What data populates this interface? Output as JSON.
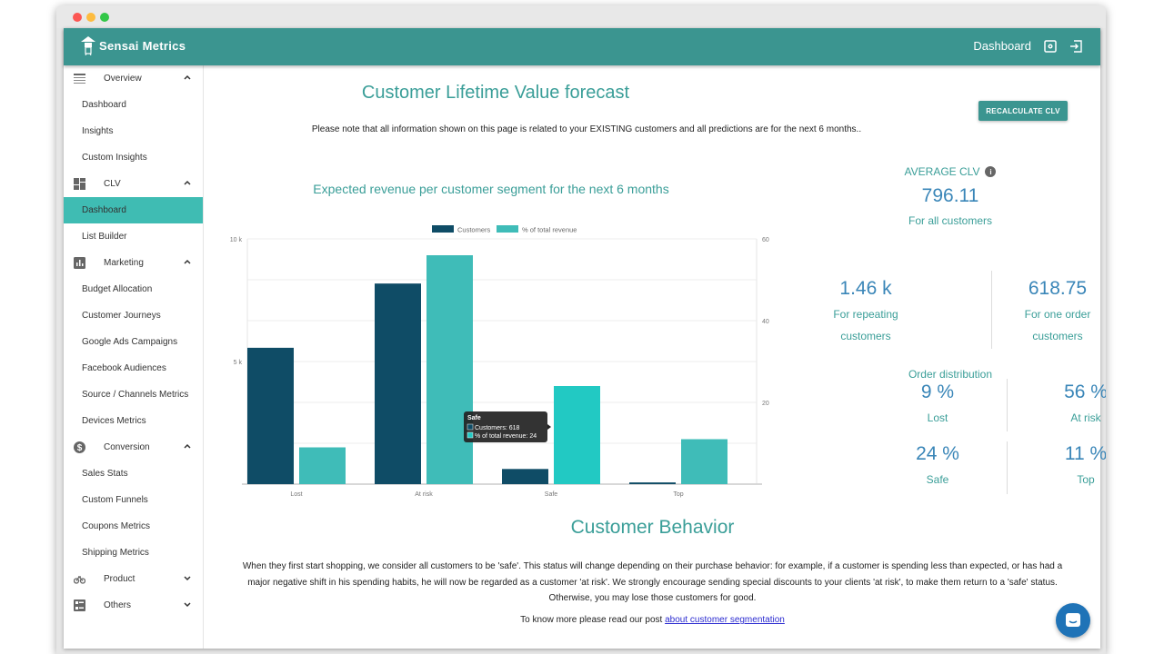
{
  "app": {
    "name": "Sensai Metrics",
    "header_page_label": "Dashboard"
  },
  "sidebar": {
    "groups": [
      {
        "label": "Overview",
        "icon": "table-icon",
        "expanded": true,
        "items": [
          "Dashboard",
          "Insights",
          "Custom Insights"
        ]
      },
      {
        "label": "CLV",
        "icon": "dashboard-icon",
        "expanded": true,
        "items": [
          "Dashboard",
          "List Builder"
        ],
        "active_item": "Dashboard"
      },
      {
        "label": "Marketing",
        "icon": "bar-chart-icon",
        "expanded": true,
        "items": [
          "Budget Allocation",
          "Customer Journeys",
          "Google Ads Campaigns",
          "Facebook Audiences",
          "Source / Channels Metrics",
          "Devices Metrics"
        ]
      },
      {
        "label": "Conversion",
        "icon": "dollar-icon",
        "expanded": true,
        "items": [
          "Sales Stats",
          "Custom Funnels",
          "Coupons Metrics",
          "Shipping Metrics"
        ]
      },
      {
        "label": "Product",
        "icon": "bike-icon",
        "expanded": false,
        "items": []
      },
      {
        "label": "Others",
        "icon": "list-icon",
        "expanded": false,
        "items": []
      }
    ]
  },
  "main": {
    "title": "Customer Lifetime Value forecast",
    "notice": "Please note that all information shown on this page is related to your EXISTING customers and all predictions are for the next 6 months..",
    "recalc_button": "RECALCULATE CLV",
    "average": {
      "label": "AVERAGE CLV",
      "value": "796.11",
      "sub": "For all customers"
    },
    "repeating": {
      "value": "1.46 k",
      "sub1": "For repeating",
      "sub2": "customers"
    },
    "one_order": {
      "value": "618.75",
      "sub1": "For one order",
      "sub2": "customers"
    },
    "order_distribution": {
      "title": "Order distribution",
      "items": [
        {
          "value": "9 %",
          "label": "Lost"
        },
        {
          "value": "56 %",
          "label": "At risk"
        },
        {
          "value": "24 %",
          "label": "Safe"
        },
        {
          "value": "11 %",
          "label": "Top"
        }
      ]
    },
    "behavior": {
      "title": "Customer Behavior",
      "line1": "When they first start shopping, we consider all customers to be 'safe'. This status will change depending on their purchase behavior: for example, if a customer is spending less than expected, or has had a",
      "line2": "major negative shift in his spending habits, he will now be regarded as a customer 'at risk'. We strongly encourage sending special discounts to your clients 'at risk', to make them return to a 'safe' status.",
      "line3": "Otherwise, you may lose those customers for good.",
      "more_prefix": "To know more please read our post ",
      "more_link": "about customer segmentation"
    }
  },
  "chart_data": {
    "type": "bar",
    "title": "Expected revenue per customer segment for the next 6 months",
    "categories": [
      "Lost",
      "At risk",
      "Safe",
      "Top"
    ],
    "series": [
      {
        "name": "Customers",
        "axis": "left",
        "color": "#0f4c66",
        "values": [
          5560,
          8180,
          618,
          70
        ]
      },
      {
        "name": "% of total revenue",
        "axis": "right",
        "color": "#3fbcb8",
        "values": [
          9,
          56,
          24,
          11
        ]
      }
    ],
    "left_axis": {
      "ticks": [
        "5 k",
        "10 k"
      ],
      "tick_values": [
        5000,
        10000
      ],
      "range": [
        0,
        10000
      ]
    },
    "right_axis": {
      "ticks": [
        "20",
        "40",
        "60"
      ],
      "tick_values": [
        20,
        40,
        60
      ],
      "range": [
        0,
        60
      ]
    },
    "legend": "top-center",
    "highlight_color": "#22c9c3",
    "tooltip": {
      "category": "Safe",
      "title": "Safe",
      "line1": "Customers: 618",
      "line2": "% of total revenue: 24"
    }
  }
}
